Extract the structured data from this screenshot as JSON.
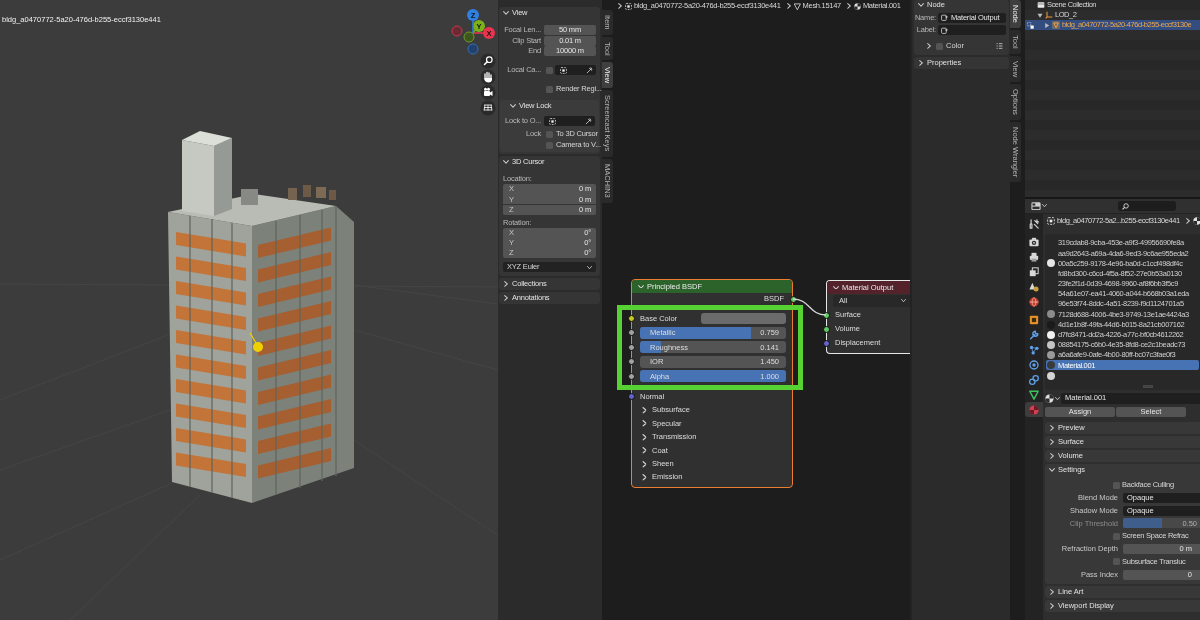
{
  "viewport": {
    "object_name": "bldg_a0470772-5a20-476d-b255-eccf3130e441",
    "axis_labels": [
      "X",
      "Y",
      "Z"
    ]
  },
  "viewport_sidebar": {
    "tabs": [
      {
        "label": "Item",
        "selected": false
      },
      {
        "label": "Tool",
        "selected": false
      },
      {
        "label": "View",
        "selected": true
      },
      {
        "label": "Screencast Keys",
        "selected": false
      },
      {
        "label": "MACHIN3",
        "selected": false
      }
    ],
    "panels": [
      {
        "title": "View",
        "expanded": true,
        "rows": [
          {
            "kind": "number",
            "label": "Focal Len...",
            "value": "50 mm"
          },
          {
            "kind": "number",
            "label": "Clip Start",
            "value": "0.01 m"
          },
          {
            "kind": "number",
            "label": "End",
            "value": "10000 m"
          },
          {
            "kind": "object",
            "label": "Local Ca...",
            "checked": false
          },
          {
            "kind": "check",
            "text": "Render Regi...",
            "checked": false
          },
          {
            "kind": "subpanel",
            "title": "View Lock",
            "expanded": true,
            "rows": [
              {
                "kind": "object",
                "label": "Lock to O..."
              },
              {
                "kind": "check",
                "label": "Lock",
                "text": "To 3D Cursor",
                "checked": false
              },
              {
                "kind": "check",
                "text": "Camera to V...",
                "checked": false
              }
            ]
          }
        ]
      },
      {
        "title": "3D Cursor",
        "expanded": true,
        "rows": [
          {
            "kind": "heading",
            "label": "Location:"
          },
          {
            "kind": "vector",
            "items": [
              {
                "label": "X",
                "value": "0 m"
              },
              {
                "label": "Y",
                "value": "0 m"
              },
              {
                "label": "Z",
                "value": "0 m"
              }
            ]
          },
          {
            "kind": "heading",
            "label": "Rotation:"
          },
          {
            "kind": "vector",
            "items": [
              {
                "label": "X",
                "value": "0°"
              },
              {
                "label": "Y",
                "value": "0°"
              },
              {
                "label": "Z",
                "value": "0°"
              }
            ]
          },
          {
            "kind": "dropdown",
            "value": "XYZ Euler"
          }
        ]
      },
      {
        "title": "Collections",
        "expanded": false
      },
      {
        "title": "Annotations",
        "expanded": false
      }
    ]
  },
  "node_editor": {
    "breadcrumb": [
      {
        "kind": "object",
        "label": "bldg_a0470772-5a20-476d-b255-eccf3130e441"
      },
      {
        "kind": "mesh",
        "label": "Mesh.15147"
      },
      {
        "kind": "material",
        "label": "Material.001"
      }
    ],
    "nodes": [
      {
        "title": "Principled BSDF",
        "kind": "shader",
        "selected": true,
        "active": false,
        "expanded": true,
        "outputs": [
          {
            "label": "BSDF",
            "kind": "shader",
            "linked": true
          }
        ],
        "input_groups": [
          {
            "highlighted": true,
            "inputs": [
              {
                "label": "Base Color",
                "kind": "color",
                "color": "#6b6b6b"
              },
              {
                "label": "Metallic",
                "kind": "factor",
                "value": "0.759",
                "level": 0.759
              },
              {
                "label": "Roughness",
                "kind": "factor",
                "value": "0.141",
                "level": 0.141
              },
              {
                "label": "IOR",
                "kind": "number",
                "value": "1.450"
              },
              {
                "label": "Alpha",
                "kind": "factor",
                "value": "1.000",
                "level": 1
              }
            ]
          },
          {
            "highlighted": false,
            "inputs": [
              {
                "label": "Normal",
                "kind": "vector"
              }
            ]
          }
        ],
        "panels": [
          {
            "label": "Subsurface",
            "expanded": false
          },
          {
            "label": "Specular",
            "expanded": false
          },
          {
            "label": "Transmission",
            "expanded": false
          },
          {
            "label": "Coat",
            "expanded": false
          },
          {
            "label": "Sheen",
            "expanded": false
          },
          {
            "label": "Emission",
            "expanded": false
          }
        ]
      },
      {
        "title": "Material Output",
        "kind": "output",
        "selected": true,
        "active": true,
        "expanded": true,
        "target": "All",
        "inputs": [
          {
            "label": "Surface",
            "kind": "shader",
            "linked": true
          },
          {
            "label": "Volume",
            "kind": "shader",
            "linked": false
          },
          {
            "label": "Displacement",
            "kind": "vector",
            "linked": false
          }
        ]
      }
    ]
  },
  "node_sidebar": {
    "tabs": [
      {
        "label": "Node",
        "selected": true
      },
      {
        "label": "Tool",
        "selected": false
      },
      {
        "label": "View",
        "selected": false
      },
      {
        "label": "Options",
        "selected": false
      },
      {
        "label": "Node Wrangler",
        "selected": false
      }
    ],
    "panels": [
      {
        "title": "Node",
        "expanded": true,
        "fields": [
          {
            "label": "Name:",
            "value": "Material Output"
          },
          {
            "label": "Label:"
          }
        ],
        "subpanels": [
          {
            "title": "Color",
            "expanded": false,
            "checked": false
          }
        ]
      },
      {
        "title": "Properties",
        "expanded": false
      }
    ]
  },
  "outliner": {
    "rows": [
      {
        "label": "Scene Collection",
        "kind": "collection",
        "selected": false,
        "children": [
          {
            "label": "LOD_2",
            "kind": "empty",
            "expanded": true,
            "selected": false,
            "children": [
              {
                "label": "bldg_a0470772-5a20-476d-b255-eccf3130e",
                "kind": "mesh",
                "expanded": false,
                "selected": true
              }
            ]
          }
        ]
      }
    ]
  },
  "properties": {
    "tabs": [
      {
        "kind": "tool",
        "selected": false
      },
      {
        "kind": "render",
        "selected": false
      },
      {
        "kind": "output",
        "selected": false
      },
      {
        "kind": "view_layer",
        "selected": false
      },
      {
        "kind": "scene",
        "selected": false
      },
      {
        "kind": "world",
        "selected": false
      },
      {
        "kind": "object",
        "selected": false
      },
      {
        "kind": "modifiers",
        "selected": false
      },
      {
        "kind": "particles",
        "selected": false
      },
      {
        "kind": "physics",
        "selected": false
      },
      {
        "kind": "constraints",
        "selected": false
      },
      {
        "kind": "data",
        "selected": false
      },
      {
        "kind": "material",
        "selected": true
      }
    ],
    "breadcrumb": [
      {
        "kind": "object",
        "label": "bldg_a0470772-5a2...b255-eccf3130e441"
      },
      {
        "kind": "material"
      }
    ],
    "slots": [
      {
        "name": "319cdab8-9cba-453e-a9f3-49956690fe8a",
        "selected": false
      },
      {
        "name": "aa9d2643-a69a-4da6-9ed3-9c6ae955eda2",
        "selected": false
      },
      {
        "name": "00a5c259-9178-4e96-ba0d-c1ccf498df4c",
        "color": "#e6e6e6",
        "selected": false
      },
      {
        "name": "fd8bd300-c6cd-4f5a-8f52-27e0b53a0130",
        "selected": false
      },
      {
        "name": "23fe2f1d-0d39-4698-9960-af8f6bb3f5c9",
        "selected": false
      },
      {
        "name": "54a61e07-ea41-4060-a044-b668b03a1eda",
        "selected": false
      },
      {
        "name": "96e53f74-8ddc-4a51-8239-f9d1124701a5",
        "selected": false
      },
      {
        "name": "7128d688-4006-4be3-9749-13e1ae4424a3",
        "color": "#8c8c8c",
        "selected": false
      },
      {
        "name": "4d1e1b8f-49fa-44d6-b015-8a21cb007162",
        "color": "#1a1a1a",
        "selected": false
      },
      {
        "name": "d7fc8471-dd2a-4226-a77c-bf0cb4612262",
        "color": "#f2f2f2",
        "selected": false
      },
      {
        "name": "08854175-c6b0-4e35-8fd8-ce2c1beadc73",
        "color": "#c4c4c4",
        "selected": false
      },
      {
        "name": "a6a6afe9-0afe-4b00-80ff-bc07c3fae0f3",
        "color": "#9a9a9a",
        "selected": false
      },
      {
        "name": "Material.001",
        "color": "#3a3a3a",
        "selected": true
      },
      {
        "color": "#d4d4d4",
        "selected": false
      }
    ],
    "material": "Material.001",
    "buttons": [
      "Assign",
      "Select"
    ],
    "panels": [
      {
        "title": "Preview",
        "expanded": false
      },
      {
        "title": "Surface",
        "expanded": false
      },
      {
        "title": "Volume",
        "expanded": false
      },
      {
        "title": "Settings",
        "expanded": true,
        "rows": [
          {
            "kind": "check",
            "text": "Backface Culling",
            "checked": false,
            "disabled": false
          },
          {
            "kind": "dropdown",
            "label": "Blend Mode",
            "value": "Opaque",
            "disabled": false
          },
          {
            "kind": "dropdown",
            "label": "Shadow Mode",
            "value": "Opaque",
            "disabled": false
          },
          {
            "kind": "slider",
            "label": "Clip Threshold",
            "value": "0.50",
            "level": 0.5,
            "disabled": true
          },
          {
            "kind": "check",
            "text": "Screen Space Refrac",
            "checked": false,
            "disabled": false
          },
          {
            "kind": "number",
            "label": "Refraction Depth",
            "value": "0 m",
            "disabled": false
          },
          {
            "kind": "check",
            "text": "Subsurface Transluc",
            "checked": false,
            "disabled": false
          },
          {
            "kind": "number",
            "label": "Pass Index",
            "value": "0",
            "disabled": false
          }
        ]
      },
      {
        "title": "Line Art",
        "expanded": false
      },
      {
        "title": "Viewport Display",
        "expanded": false
      }
    ]
  }
}
